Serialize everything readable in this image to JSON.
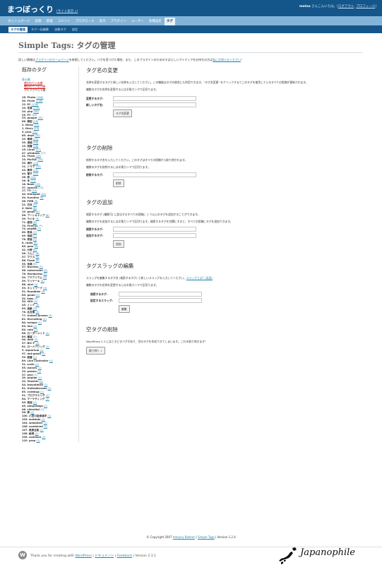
{
  "header": {
    "site_title": "まつぼっくり",
    "view_site": "(サイト表示 »)",
    "user_name": "matsu",
    "greeting": " さんこんにちは。[",
    "logout": "ログアウト",
    "sep": ", ",
    "profile": "プロフィール",
    "close": "]"
  },
  "admin_menu": [
    {
      "label": "ダッシュボード",
      "current": false
    },
    {
      "label": "投稿",
      "current": false
    },
    {
      "label": "管理",
      "current": false
    },
    {
      "label": "コメント",
      "current": false
    },
    {
      "label": "ブログロール",
      "current": false
    },
    {
      "label": "表示",
      "current": false
    },
    {
      "label": "プラグイン",
      "current": false
    },
    {
      "label": "ユーザー",
      "current": false
    },
    {
      "label": "各種設定",
      "current": false
    },
    {
      "label": "タグ",
      "current": true
    }
  ],
  "sub_menu": [
    {
      "label": "タグの管理",
      "current": true
    },
    {
      "label": "タグ一括編集",
      "current": false
    },
    {
      "label": "自動タグ",
      "current": false
    },
    {
      "label": "設定",
      "current": false
    }
  ],
  "page": {
    "title": "Simple Tags: タグの管理",
    "help_prefix": "詳しい情報は",
    "help_link": "プラグインのホームページ",
    "help_mid": "を参照してください。バグを見つけた場合、また、このプラグインのためのすばらしいアイディアをお持ちの方は",
    "help_link2": "私にお知らせください",
    "help_suffix": "！"
  },
  "tag_list": {
    "heading": "既存のタグ",
    "sort_label": "表示順：",
    "sort_options": [
      {
        "label": "使われている順",
        "current": false
      },
      {
        "label": "使われていない順",
        "current": false
      },
      {
        "label": "アルファベット順",
        "current": true
      }
    ],
    "tags": [
      {
        "n": "16.",
        "name": "Photo",
        "count": "(156)"
      },
      {
        "n": "30.",
        "name": "Flickr",
        "count": "(146)"
      },
      {
        "n": "12.",
        "name": "EC",
        "count": "(130)"
      },
      {
        "n": "10.",
        "name": "写真",
        "count": "(128)"
      },
      {
        "n": "24.",
        "name": "php",
        "count": "(44)"
      },
      {
        "n": "25.",
        "name": "PC",
        "count": "(40)"
      },
      {
        "n": "33.",
        "name": "google",
        "count": "(30)"
      },
      {
        "n": "86.",
        "name": "模型",
        "count": "(29)"
      },
      {
        "n": "2.",
        "name": "News",
        "count": "(25)"
      },
      {
        "n": "1.",
        "name": "Diary",
        "count": "(23)"
      },
      {
        "n": "5.",
        "name": "Java",
        "count": "(21)"
      },
      {
        "n": "65.",
        "name": "deps",
        "count": "(20)"
      },
      {
        "n": "29.",
        "name": "情報",
        "count": "(20)"
      },
      {
        "n": "35.",
        "name": "漫画",
        "count": "(18)"
      },
      {
        "n": "19.",
        "name": "読書",
        "count": "(18)"
      },
      {
        "n": "15.",
        "name": "Linux",
        "count": "(17)"
      },
      {
        "n": "47.",
        "name": "windows",
        "count": "(17)"
      },
      {
        "n": "41.",
        "name": "Flash",
        "count": "(16)"
      },
      {
        "n": "14.",
        "name": "MySQL",
        "count": "(14)"
      },
      {
        "n": "53.",
        "name": "海外",
        "count": "(13)"
      },
      {
        "n": "11.",
        "name": "ドラマ",
        "count": "(13)"
      },
      {
        "n": "43.",
        "name": "携帯",
        "count": "(12)"
      },
      {
        "n": "44.",
        "name": "電子",
        "count": "(12)"
      },
      {
        "n": "28.",
        "name": "旅",
        "count": "(12)"
      },
      {
        "n": "26.",
        "name": "本",
        "count": "(11)"
      },
      {
        "n": "18.",
        "name": "Book",
        "count": "(10)"
      },
      {
        "n": "37.",
        "name": "apache",
        "count": "(10)"
      },
      {
        "n": "17.",
        "name": "TV",
        "count": "(10)"
      },
      {
        "n": "44.",
        "name": "thinkpad",
        "count": "(10)"
      },
      {
        "n": "34.",
        "name": "function",
        "count": "(9)"
      },
      {
        "n": "36.",
        "name": "FMB",
        "count": "(9)"
      },
      {
        "n": "21.",
        "name": "日本",
        "count": "(9)"
      },
      {
        "n": "4.",
        "name": "Note",
        "count": "(8)"
      },
      {
        "n": "19.",
        "name": "gmail",
        "count": "(8)"
      },
      {
        "n": "56.",
        "name": "アートキャンプ",
        "count": "(8)"
      },
      {
        "n": "39.",
        "name": "ラジオ",
        "count": "(8)"
      },
      {
        "n": "71.",
        "name": "感想",
        "count": "(8)"
      },
      {
        "n": "70.",
        "name": "FireFox",
        "count": "(7)"
      },
      {
        "n": "74.",
        "name": "phpBB",
        "count": "(7)"
      },
      {
        "n": "60.",
        "name": "家具",
        "count": "(7)"
      },
      {
        "n": "49.",
        "name": "地図",
        "count": "(7)"
      },
      {
        "n": "78.",
        "name": "家屋",
        "count": "(7)"
      },
      {
        "n": "8.",
        "name": "radio",
        "count": "(6)"
      },
      {
        "n": "85.",
        "name": "gear",
        "count": "(6)"
      },
      {
        "n": "42.",
        "name": "分野",
        "count": "(6)"
      },
      {
        "n": "56.",
        "name": "うんこ",
        "count": "(6)"
      },
      {
        "n": "57.",
        "name": "マウス",
        "count": "(6)"
      },
      {
        "n": "66.",
        "name": "Flash",
        "count": "(6)"
      },
      {
        "n": "55.",
        "name": "食事",
        "count": "(6)"
      },
      {
        "n": "37.",
        "name": "Nucleus",
        "count": "(5)"
      },
      {
        "n": "58.",
        "name": "subversion",
        "count": "(5)"
      },
      {
        "n": "76.",
        "name": "Wordpress",
        "count": "(5)"
      },
      {
        "n": "54.",
        "name": "アクアリウム",
        "count": "(5)"
      },
      {
        "n": "59.",
        "name": "マイケーキ",
        "count": "(5)"
      },
      {
        "n": "68.",
        "name": "mixi",
        "count": "(4)"
      },
      {
        "n": "53.",
        "name": "ネットワーク",
        "count": "(4)"
      },
      {
        "n": "51.",
        "name": "Roadbike",
        "count": "(4)"
      },
      {
        "n": "65.",
        "name": "gmail",
        "count": "(3)"
      },
      {
        "n": "52.",
        "name": "tabs",
        "count": "(3)"
      },
      {
        "n": "50.",
        "name": "SEO",
        "count": "(3)"
      },
      {
        "n": "45.",
        "name": "インド",
        "count": "(3)"
      },
      {
        "n": "63.",
        "name": "高齢",
        "count": "(3)"
      },
      {
        "n": "76.",
        "name": "名言集",
        "count": "(3)"
      },
      {
        "n": "77.",
        "name": "United Arrows",
        "count": "(3)"
      },
      {
        "n": "81.",
        "name": "Recruiting",
        "count": "(2)"
      },
      {
        "n": "80.",
        "name": "eclipse",
        "count": "(2)"
      },
      {
        "n": "83.",
        "name": "imo",
        "count": "(2)"
      },
      {
        "n": "84.",
        "name": "vaio",
        "count": "(2)"
      },
      {
        "n": "88.",
        "name": "ローダーメイド",
        "count": "(2)"
      },
      {
        "n": "89.",
        "name": "審査",
        "count": "(2)"
      },
      {
        "n": "90.",
        "name": "dmil",
        "count": "(2)"
      },
      {
        "n": "37.",
        "name": "BIC-F",
        "count": "(1)"
      },
      {
        "n": "61.",
        "name": "ロードバリング",
        "count": "(1)"
      },
      {
        "n": "9.",
        "name": "aquarium",
        "count": "(1)"
      },
      {
        "n": "97.",
        "name": "dot-gmail",
        "count": "(1)"
      },
      {
        "n": "99.",
        "name": "図書",
        "count": "(1)"
      },
      {
        "n": "89.",
        "name": "Line Controller",
        "count": "(1)"
      },
      {
        "n": "31.",
        "name": "scsle",
        "count": "(1)"
      },
      {
        "n": "55.",
        "name": "jsoncis",
        "count": "(1)"
      },
      {
        "n": "29.",
        "name": "pasmo",
        "count": "(1)"
      },
      {
        "n": "37.",
        "name": "pecl",
        "count": "(1)"
      },
      {
        "n": "39.",
        "name": "phpide",
        "count": "(1)"
      },
      {
        "n": "22.",
        "name": "Shoshin",
        "count": "(1)"
      },
      {
        "n": "44.",
        "name": "tokyotimez",
        "count": "(1)"
      },
      {
        "n": "61.",
        "name": "UnitedArrows",
        "count": "(1)"
      },
      {
        "n": "63.",
        "name": "vcdebug",
        "count": "(1)"
      },
      {
        "n": "51.",
        "name": "プログラミング",
        "count": "(1)"
      },
      {
        "n": "64.",
        "name": "マーケティング",
        "count": "(1)"
      },
      {
        "n": "45.",
        "name": "発展",
        "count": "(1)"
      },
      {
        "n": "49.",
        "name": "simpletags",
        "count": "(1)"
      },
      {
        "n": "46.",
        "name": "climcttal",
        "count": "(1)"
      },
      {
        "n": "98.",
        "name": "夢",
        "count": "(1)"
      },
      {
        "n": "100.",
        "name": "小豆の語源漢字",
        "count": "(1)"
      },
      {
        "n": "103.",
        "name": "wotdots",
        "count": "(1)"
      },
      {
        "n": "104.",
        "name": "webalizer",
        "count": "(1)"
      },
      {
        "n": "106.",
        "name": "combined",
        "count": "(1)"
      },
      {
        "n": "107.",
        "name": "風景全般",
        "count": "(1)"
      },
      {
        "n": "108.",
        "name": "絵柄",
        "count": "(1)"
      },
      {
        "n": "109.",
        "name": "common",
        "count": "(1)"
      },
      {
        "n": "110.",
        "name": "grep",
        "count": "(1)"
      }
    ]
  },
  "rename": {
    "title": "タグ名の変更",
    "desc": "名称を変更するタグと新しい名称を入力してください。この機能はタグの統合にも利用できます。\"タグ名変更\" をクリックするとこのタグを使用しているすべての投稿が更新されます。",
    "hint": "複数のタグの名称を変更するには半角カンマで区切ります。",
    "label_old": "変更するタグ:",
    "label_new": "新しいタグ名:",
    "button": "タグ名変更"
  },
  "delete": {
    "title": "タグの削除",
    "desc": "削除するタグ名を入力してください。このタグはすべての投稿から取り除かれます。",
    "hint": "複数のタグを削除するには半角カンマで区切ります。",
    "label": "削除するタグ:",
    "button": "削除"
  },
  "add": {
    "title": "タグの追加",
    "desc": "検索するタグ (複数可) に該当するすべての投稿に 1 つ以上のタグを追加することができます。",
    "hint": "複数のタグを追加するには半角カンマで区切ります。検索するタグを空欄にすると、すべての投稿にタグを追加できます。",
    "label_search": "検索するタグ:",
    "label_add": "追加するタグ:",
    "button": "追加"
  },
  "slug": {
    "title": "タグスラッグの編集",
    "desc": "スラッグを編集するタグ名 (検索するタグ) と新しいスラッグを入力してください。",
    "desc_link": "スラッグとは？(英語)",
    "hint": "複数のタグの名称を変更するには半角カンマで区切ります。",
    "label_search": "検索するタグ:",
    "label_slug": "設定するスラッグ:",
    "button": "編集"
  },
  "empty": {
    "title": "空タグの削除",
    "desc": "WordPress 2.3 にはときどきバグがあり、空のタグを作成できてしまいます。これを取り除きます！",
    "button": "取り除く »"
  },
  "footer": {
    "text": "© Copyright 2007",
    "author": "Amaury Balmer",
    "sep": " | ",
    "plugin": "Simple Tags",
    "version": " | Version 1.2.4"
  },
  "bottom": {
    "thanks": "Thank you for creating with",
    "wp": "WordPress",
    "sep1": " | ",
    "docs": "ドキュメント",
    "sep2": " | ",
    "feedback": "Feedback",
    "version": " | Version 2.3.1",
    "watermark": "Japanophile"
  }
}
